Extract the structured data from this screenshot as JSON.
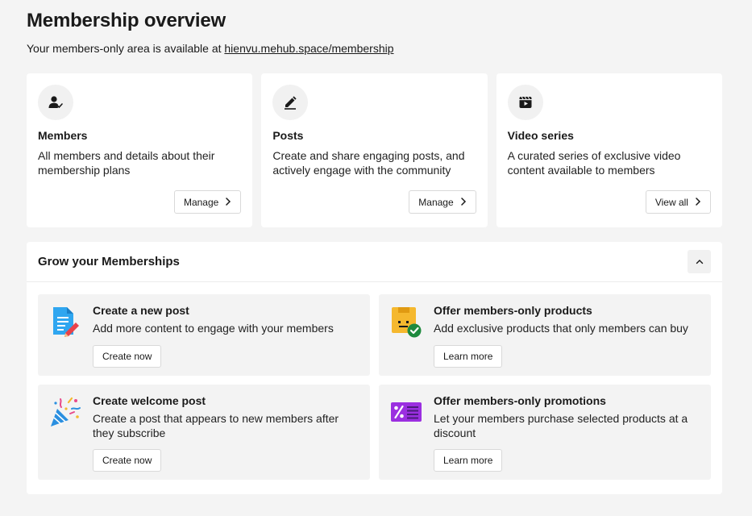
{
  "header": {
    "title": "Membership overview",
    "subtitle_prefix": "Your members-only area is available at ",
    "subtitle_link": "hienvu.mehub.space/membership"
  },
  "cards": [
    {
      "icon": "member-icon",
      "title": "Members",
      "description": "All members and details about their membership plans",
      "button": "Manage"
    },
    {
      "icon": "pencil-icon",
      "title": "Posts",
      "description": "Create and share engaging posts, and actively engage with the community",
      "button": "Manage"
    },
    {
      "icon": "video-icon",
      "title": "Video series",
      "description": "A curated series of exclusive video content available to members",
      "button": "View all"
    }
  ],
  "grow": {
    "title": "Grow your Memberships",
    "tiles": [
      {
        "icon": "document-edit-icon",
        "title": "Create a new post",
        "description": "Add more content to engage with your members",
        "button": "Create now"
      },
      {
        "icon": "product-check-icon",
        "title": "Offer members-only products",
        "description": "Add exclusive products that only members can buy",
        "button": "Learn more"
      },
      {
        "icon": "party-popper-icon",
        "title": "Create welcome post",
        "description": "Create a post that appears to new members after they subscribe",
        "button": "Create now"
      },
      {
        "icon": "discount-icon",
        "title": "Offer members-only promotions",
        "description": "Let your members purchase selected products at a discount",
        "button": "Learn more"
      }
    ]
  },
  "colors": {
    "background": "#f4f4f4",
    "card": "#ffffff",
    "tile": "#f3f3f3",
    "check_green": "#1e8a3e",
    "promo_purple": "#9b2fe0"
  }
}
